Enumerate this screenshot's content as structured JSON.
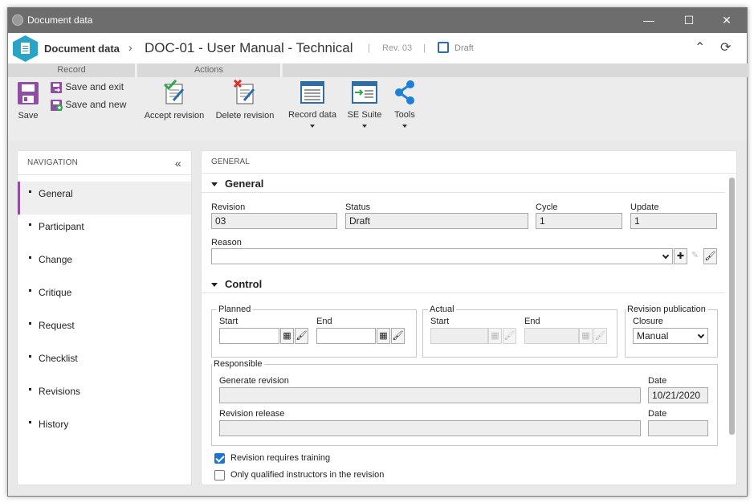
{
  "window": {
    "title": "Document data",
    "minimize": "—",
    "maximize": "☐",
    "close": "✕"
  },
  "header": {
    "app_name": "Document data",
    "separator": "›",
    "doc_title": "DOC-01 - User Manual - Technical",
    "divider": "|",
    "revision": "Rev. 03",
    "status": "Draft"
  },
  "ribbon": {
    "record": {
      "label": "Record",
      "save": "Save",
      "save_exit": "Save and exit",
      "save_new": "Save and new"
    },
    "actions": {
      "label": "Actions",
      "accept_revision": "Accept revision",
      "delete_revision": "Delete revision"
    },
    "more": {
      "record_data": "Record data",
      "se_suite": "SE Suite",
      "tools": "Tools"
    }
  },
  "navigation": {
    "title": "NAVIGATION",
    "collapse": "«",
    "items": [
      "General",
      "Participant",
      "Change",
      "Critique",
      "Request",
      "Checklist",
      "Revisions",
      "History"
    ],
    "active": "General"
  },
  "main": {
    "header": "GENERAL",
    "general": {
      "title": "General",
      "revision_label": "Revision",
      "revision_value": "03",
      "status_label": "Status",
      "status_value": "Draft",
      "cycle_label": "Cycle",
      "cycle_value": "1",
      "update_label": "Update",
      "update_value": "1",
      "reason_label": "Reason",
      "reason_value": ""
    },
    "control": {
      "title": "Control",
      "planned": {
        "legend": "Planned",
        "start_label": "Start",
        "end_label": "End",
        "start_value": "",
        "end_value": ""
      },
      "actual": {
        "legend": "Actual",
        "start_label": "Start",
        "end_label": "End",
        "start_value": "",
        "end_value": ""
      },
      "publication": {
        "legend": "Revision publication",
        "closure_label": "Closure",
        "closure_value": "Manual"
      },
      "responsible": {
        "legend": "Responsible",
        "generate_label": "Generate revision",
        "generate_value": "",
        "date1_label": "Date",
        "date1_value": "10/21/2020",
        "release_label": "Revision release",
        "release_value": "",
        "date2_label": "Date",
        "date2_value": ""
      },
      "training_label": "Revision requires training",
      "training_checked": true,
      "instructors_label": "Only qualified instructors in the revision",
      "instructors_checked": false
    }
  },
  "colors": {
    "accent": "#8e4fa3",
    "brand": "#27a4c6",
    "checkbox": "#1a73d9",
    "titlebar": "#6d6d6d"
  }
}
